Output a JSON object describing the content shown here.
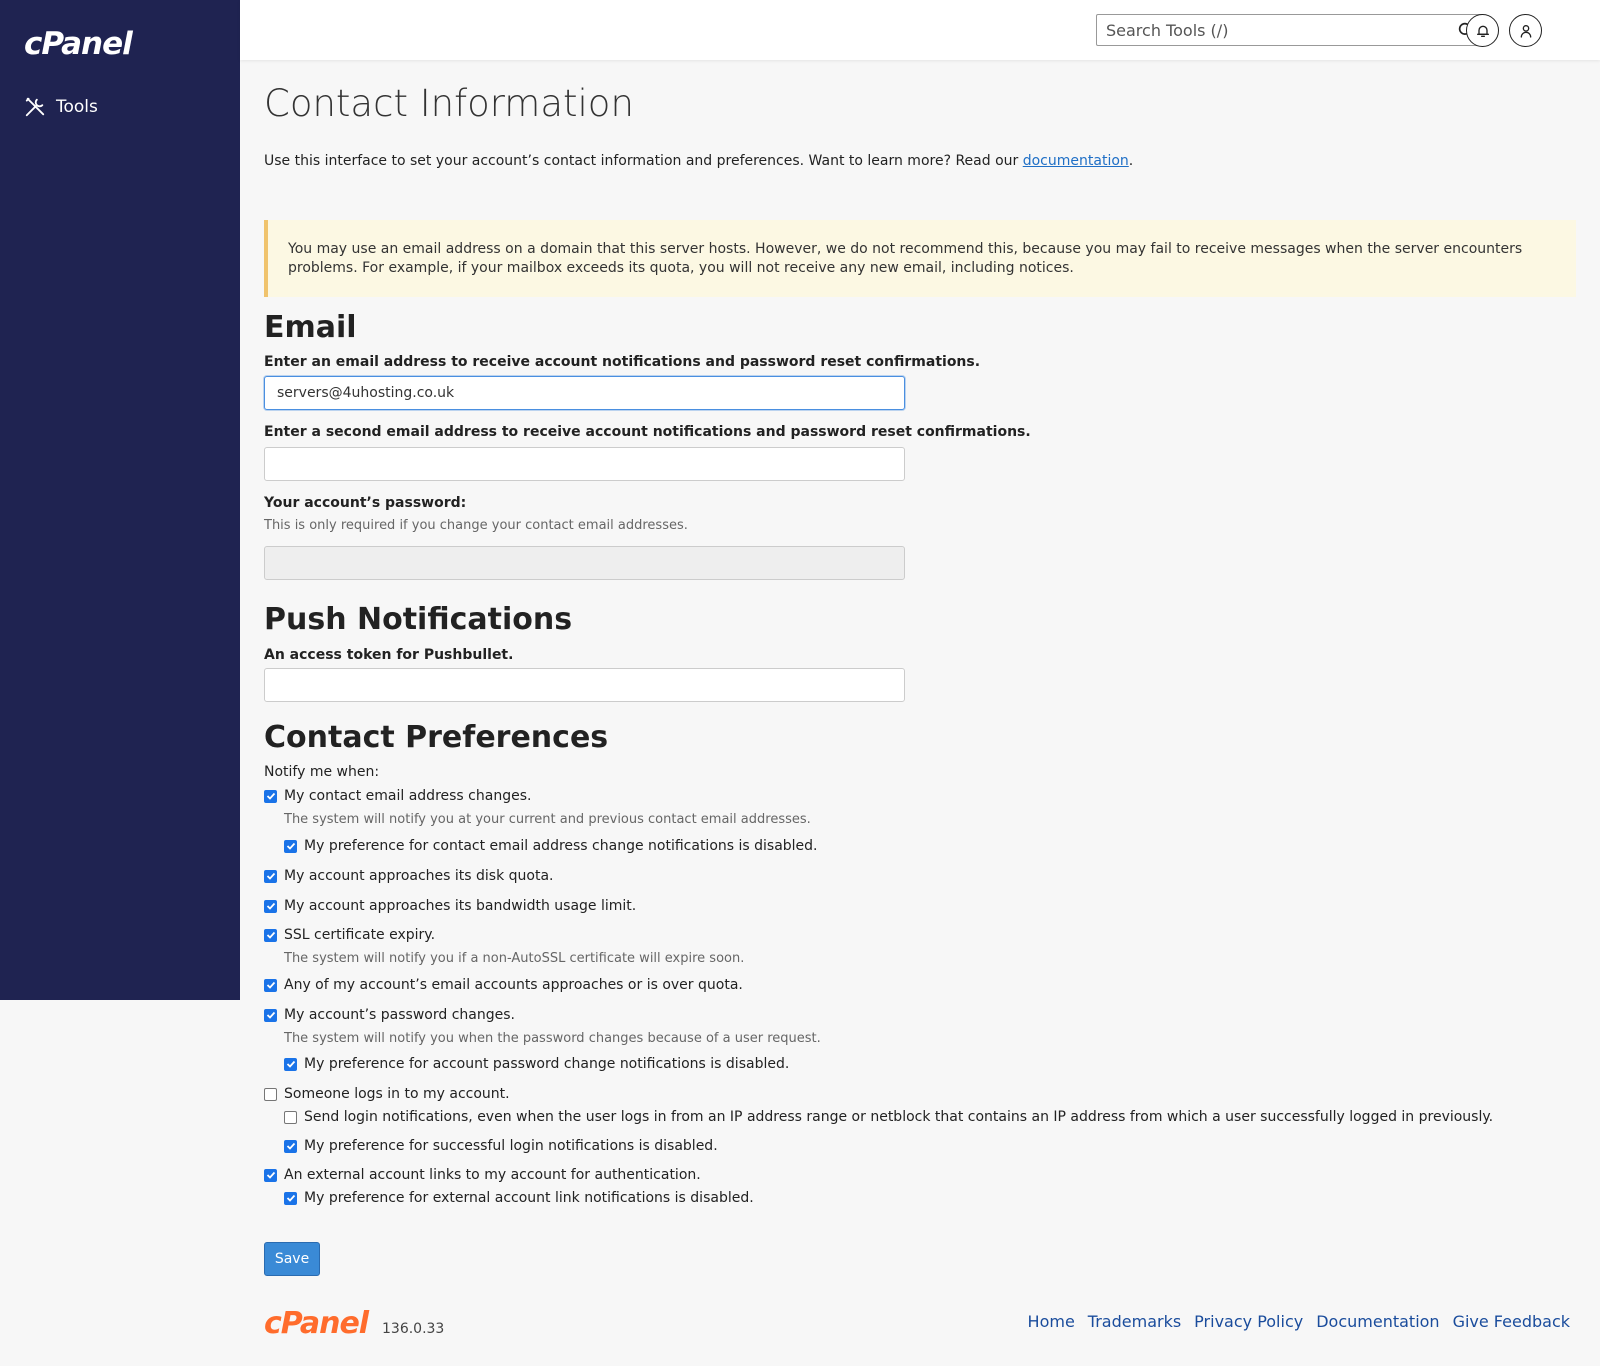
{
  "app": {
    "logo_text": "cPanel"
  },
  "sidebar": {
    "items": [
      {
        "label": "Tools",
        "icon": "tools-icon"
      }
    ]
  },
  "topbar": {
    "search_placeholder": "Search Tools (/)",
    "icons": [
      "search-icon",
      "bell-icon",
      "user-icon"
    ]
  },
  "page": {
    "title": "Contact Information",
    "intro_text": "Use this interface to set your account’s contact information and preferences. Want to learn more? Read our ",
    "intro_link": "documentation",
    "intro_end": "."
  },
  "warning": {
    "text": "You may use an email address on a domain that this server hosts. However, we do not recommend this, because you may fail to receive messages when the server encounters problems. For example, if your mailbox exceeds its quota, you will not receive any new email, including notices."
  },
  "email_section": {
    "heading": "Email",
    "email1_label": "Enter an email address to receive account notifications and password reset confirmations.",
    "email1_value": "servers@4uhosting.co.uk",
    "email2_label": "Enter a second email address to receive account notifications and password reset confirmations.",
    "email2_value": "",
    "password_label": "Your account’s password:",
    "password_help": "This is only required if you change your contact email addresses.",
    "password_value": ""
  },
  "push_section": {
    "heading": "Push Notifications",
    "token_label": "An access token for Pushbullet.",
    "token_value": ""
  },
  "prefs_section": {
    "heading": "Contact Preferences",
    "notify_label": "Notify me when:",
    "items": [
      {
        "label": "My contact email address changes.",
        "checked": true
      },
      {
        "label": "The system will notify you at your current and previous contact email addresses."
      },
      {
        "label": "My preference for contact email address change notifications is disabled.",
        "checked": true
      },
      {
        "label": "My account approaches its disk quota.",
        "checked": true
      },
      {
        "label": "My account approaches its bandwidth usage limit.",
        "checked": true
      },
      {
        "label": "SSL certificate expiry.",
        "checked": true
      },
      {
        "label": "The system will notify you if a non-AutoSSL certificate will expire soon."
      },
      {
        "label": "Any of my account’s email accounts approaches or is over quota.",
        "checked": true
      },
      {
        "label": "My account’s password changes.",
        "checked": true
      },
      {
        "label": "The system will notify you when the password changes because of a user request."
      },
      {
        "label": "My preference for account password change notifications is disabled.",
        "checked": true
      },
      {
        "label": "Someone logs in to my account.",
        "checked": false
      },
      {
        "label": "Send login notifications, even when the user logs in from an IP address range or netblock that contains an IP address from which a user successfully logged in previously.",
        "checked": false
      },
      {
        "label": "My preference for successful login notifications is disabled.",
        "checked": true
      },
      {
        "label": "An external account links to my account for authentication.",
        "checked": true
      },
      {
        "label": "My preference for external account link notifications is disabled.",
        "checked": true
      }
    ]
  },
  "save_label": "Save",
  "footer": {
    "logo_text": "cPanel",
    "version": "136.0.33",
    "links": [
      "Home",
      "Trademarks",
      "Privacy Policy",
      "Documentation",
      "Give Feedback"
    ]
  },
  "colors": {
    "sidebar_bg": "#1f2351",
    "accent": "#3a8ad6",
    "footer_logo": "#ff6c2c",
    "warning_bg": "#fcf8e3"
  }
}
